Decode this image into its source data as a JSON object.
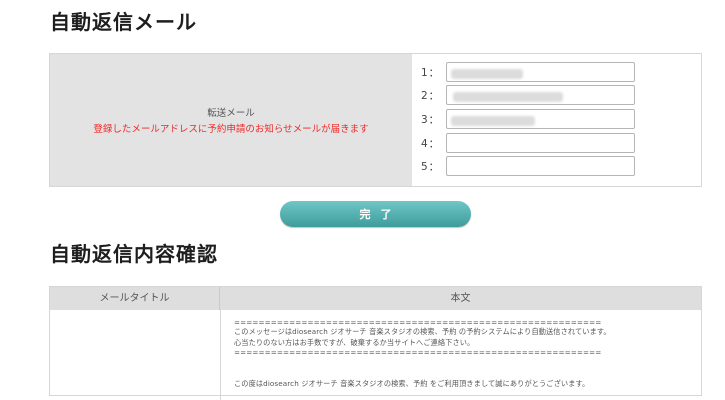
{
  "auto_reply": {
    "title": "自動返信メール",
    "forward_label": "転送メール",
    "forward_note": "登録したメールアドレスに予約申請のお知らせメールが届きます",
    "rows": [
      {
        "num": "1："
      },
      {
        "num": "2："
      },
      {
        "num": "3："
      },
      {
        "num": "4："
      },
      {
        "num": "5："
      }
    ],
    "done_label": "完了"
  },
  "content": {
    "title": "自動返信内容確認",
    "col_title": "メールタイトル",
    "col_body": "本文",
    "body_lines": [
      "============================================================",
      "このメッセージはdiosearch ジオサーチ 音楽スタジオの検索、予約 の予約システムにより自動送信されています。",
      "心当たりのない方はお手数ですが、破棄するか当サイトへご連絡下さい。",
      "============================================================",
      "この度はdiosearch ジオサーチ 音楽スタジオの検索、予約 をご利用頂きまして誠にありがとうございます。"
    ]
  }
}
